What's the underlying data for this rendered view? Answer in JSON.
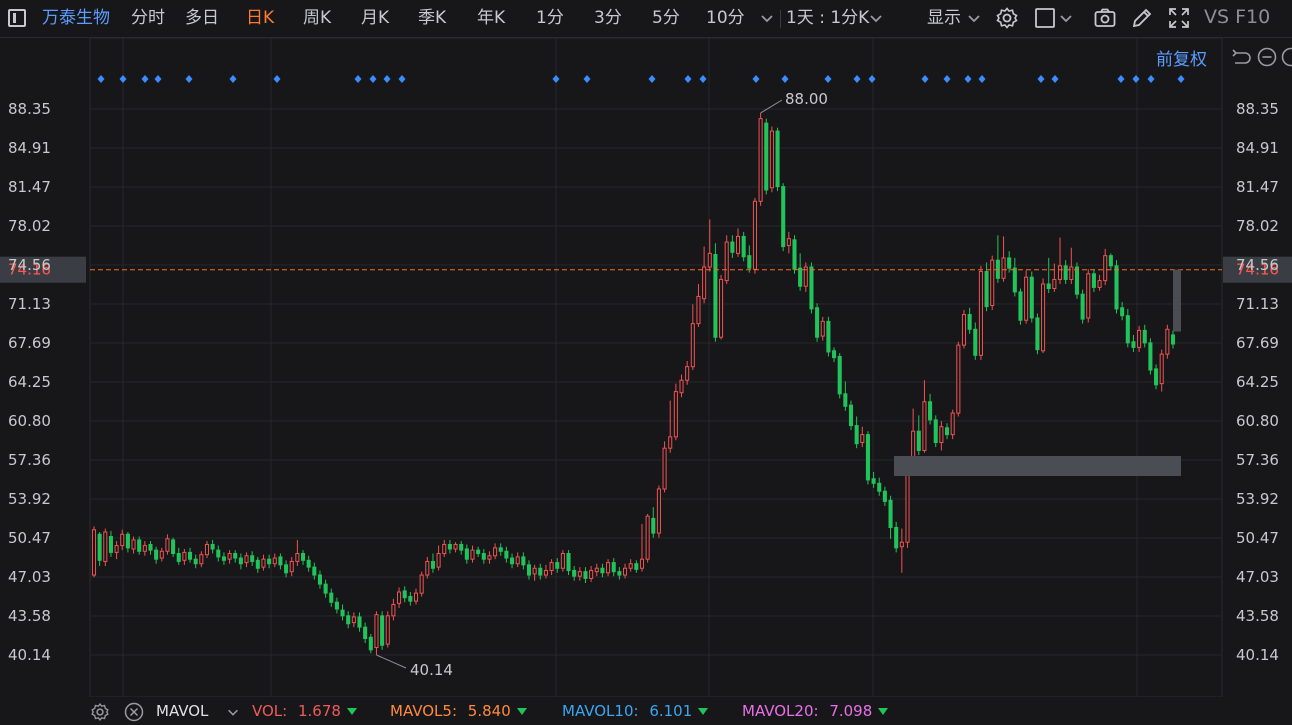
{
  "toolbar": {
    "stock_name": "万泰生物",
    "tabs": [
      "分时",
      "多日",
      "日K",
      "周K",
      "月K",
      "季K",
      "年K",
      "1分",
      "3分",
      "5分",
      "10分"
    ],
    "active_tab": "日K",
    "period_select": "1天 : 1分K",
    "display_label": "显示",
    "f10_label": "VS F10"
  },
  "row2": {
    "adjust_label": "前复权"
  },
  "chart_data": {
    "type": "candlestick",
    "y_axis_ticks": [
      "88.35",
      "84.91",
      "81.47",
      "78.02",
      "74.56",
      "71.13",
      "67.69",
      "64.25",
      "60.80",
      "57.36",
      "53.92",
      "50.47",
      "47.03",
      "43.58",
      "40.14"
    ],
    "ylim": [
      40.14,
      88.35
    ],
    "current_price": "74.16",
    "high_annotation": "88.00",
    "low_annotation": "40.14",
    "up_color": "#f05252",
    "down_color": "#21c45a",
    "candles": [
      [
        47.2,
        51.2,
        47.0,
        51.5
      ],
      [
        50.8,
        48.5,
        48.0,
        51.0
      ],
      [
        48.4,
        51.0,
        48.0,
        51.3
      ],
      [
        50.6,
        49.2,
        48.8,
        51.1
      ],
      [
        49.2,
        49.8,
        48.6,
        50.2
      ],
      [
        49.8,
        50.8,
        49.4,
        51.2
      ],
      [
        50.8,
        49.6,
        49.2,
        51.0
      ],
      [
        49.5,
        50.3,
        49.1,
        50.6
      ],
      [
        50.3,
        49.3,
        49.0,
        50.6
      ],
      [
        49.3,
        49.8,
        48.9,
        50.2
      ],
      [
        49.9,
        49.4,
        49.0,
        50.2
      ],
      [
        49.4,
        48.6,
        48.2,
        49.7
      ],
      [
        48.7,
        49.3,
        48.4,
        49.6
      ],
      [
        49.3,
        50.4,
        49.0,
        50.8
      ],
      [
        50.3,
        49.1,
        48.8,
        50.5
      ],
      [
        49.1,
        48.4,
        48.1,
        49.6
      ],
      [
        48.5,
        49.2,
        48.1,
        49.5
      ],
      [
        49.2,
        48.6,
        48.3,
        49.6
      ],
      [
        48.6,
        48.2,
        47.8,
        49.0
      ],
      [
        48.2,
        49.0,
        47.9,
        49.3
      ],
      [
        49.0,
        49.9,
        48.7,
        50.2
      ],
      [
        49.9,
        49.5,
        49.1,
        50.3
      ],
      [
        49.4,
        48.8,
        48.4,
        49.8
      ],
      [
        48.8,
        48.5,
        48.1,
        49.2
      ],
      [
        48.6,
        49.1,
        48.2,
        49.4
      ],
      [
        49.1,
        48.7,
        48.3,
        49.4
      ],
      [
        48.7,
        48.2,
        47.7,
        49.1
      ],
      [
        48.3,
        48.9,
        47.9,
        49.2
      ],
      [
        48.9,
        48.4,
        48.0,
        49.3
      ],
      [
        48.5,
        47.8,
        47.4,
        48.8
      ],
      [
        47.9,
        48.6,
        47.6,
        49.0
      ],
      [
        48.6,
        48.2,
        47.8,
        49.0
      ],
      [
        48.2,
        48.7,
        47.9,
        49.1
      ],
      [
        48.8,
        48.1,
        47.7,
        49.1
      ],
      [
        48.1,
        47.4,
        47.0,
        48.5
      ],
      [
        47.5,
        48.4,
        47.1,
        48.8
      ],
      [
        48.4,
        49.1,
        48.0,
        50.3
      ],
      [
        49.1,
        48.5,
        48.1,
        49.4
      ],
      [
        48.5,
        47.9,
        47.5,
        48.9
      ],
      [
        47.9,
        47.2,
        46.8,
        48.3
      ],
      [
        47.2,
        46.4,
        46.0,
        47.6
      ],
      [
        46.4,
        45.6,
        45.2,
        46.8
      ],
      [
        45.6,
        44.8,
        44.4,
        46.0
      ],
      [
        44.8,
        44.2,
        43.8,
        45.2
      ],
      [
        44.1,
        43.6,
        43.2,
        44.6
      ],
      [
        43.6,
        42.9,
        42.5,
        44.0
      ],
      [
        43.0,
        43.5,
        42.6,
        43.9
      ],
      [
        43.5,
        42.6,
        42.2,
        43.9
      ],
      [
        42.6,
        41.6,
        41.2,
        43.0
      ],
      [
        41.7,
        40.6,
        40.3,
        42.0
      ],
      [
        40.8,
        43.7,
        40.14,
        44.0
      ],
      [
        43.6,
        41.0,
        40.6,
        44.0
      ],
      [
        41.1,
        43.6,
        40.8,
        44.0
      ],
      [
        43.6,
        44.6,
        43.2,
        45.1
      ],
      [
        44.7,
        45.7,
        44.3,
        46.1
      ],
      [
        45.8,
        45.2,
        44.8,
        46.2
      ],
      [
        45.3,
        44.9,
        44.5,
        45.7
      ],
      [
        44.9,
        45.6,
        44.6,
        46.0
      ],
      [
        45.6,
        47.2,
        45.3,
        47.5
      ],
      [
        47.2,
        48.4,
        46.9,
        48.8
      ],
      [
        48.4,
        47.8,
        47.4,
        49.1
      ],
      [
        47.9,
        49.1,
        47.6,
        49.8
      ],
      [
        49.1,
        49.9,
        48.8,
        50.3
      ],
      [
        49.9,
        49.5,
        49.1,
        50.3
      ],
      [
        49.5,
        49.9,
        49.2,
        50.1
      ],
      [
        49.9,
        49.4,
        49.0,
        50.2
      ],
      [
        49.5,
        48.6,
        48.2,
        49.9
      ],
      [
        48.6,
        49.4,
        48.3,
        49.8
      ],
      [
        49.4,
        49.1,
        48.8,
        49.7
      ],
      [
        49.1,
        48.6,
        48.2,
        49.5
      ],
      [
        48.6,
        48.9,
        48.2,
        49.3
      ],
      [
        48.9,
        49.6,
        48.6,
        50.0
      ],
      [
        49.6,
        49.3,
        48.9,
        50.0
      ],
      [
        49.3,
        48.7,
        48.3,
        49.7
      ],
      [
        48.7,
        48.2,
        47.8,
        49.1
      ],
      [
        48.2,
        48.8,
        47.9,
        49.2
      ],
      [
        48.8,
        48.1,
        47.7,
        49.2
      ],
      [
        48.1,
        47.2,
        46.8,
        48.5
      ],
      [
        47.3,
        47.8,
        46.7,
        48.1
      ],
      [
        47.8,
        47.2,
        46.8,
        48.2
      ],
      [
        47.2,
        47.6,
        46.9,
        48.1
      ],
      [
        47.6,
        48.3,
        47.2,
        48.6
      ],
      [
        48.3,
        47.8,
        47.4,
        48.7
      ],
      [
        47.8,
        49.1,
        47.5,
        49.4
      ],
      [
        49.1,
        47.6,
        47.2,
        49.4
      ],
      [
        47.6,
        47.1,
        46.7,
        48.0
      ],
      [
        47.1,
        47.5,
        46.7,
        47.9
      ],
      [
        47.5,
        46.9,
        46.5,
        47.9
      ],
      [
        46.9,
        47.6,
        46.6,
        48.0
      ],
      [
        47.5,
        47.8,
        47.1,
        48.2
      ],
      [
        47.8,
        47.4,
        47.0,
        48.2
      ],
      [
        47.4,
        48.3,
        47.1,
        48.6
      ],
      [
        48.3,
        47.5,
        47.1,
        48.7
      ],
      [
        47.5,
        47.2,
        46.8,
        47.9
      ],
      [
        47.2,
        47.8,
        46.9,
        48.2
      ],
      [
        47.8,
        48.2,
        47.5,
        48.6
      ],
      [
        48.2,
        47.7,
        47.4,
        48.5
      ],
      [
        47.8,
        48.6,
        47.5,
        51.7
      ],
      [
        48.6,
        52.4,
        48.3,
        52.6
      ],
      [
        52.2,
        50.9,
        50.5,
        53.2
      ],
      [
        50.9,
        54.8,
        50.5,
        55.1
      ],
      [
        54.8,
        58.4,
        54.5,
        59.0
      ],
      [
        58.4,
        59.4,
        58.0,
        62.6
      ],
      [
        59.4,
        63.4,
        59.1,
        64.1
      ],
      [
        63.3,
        64.4,
        62.9,
        64.9
      ],
      [
        64.4,
        65.6,
        64.0,
        66.1
      ],
      [
        65.6,
        69.4,
        65.3,
        71.1
      ],
      [
        69.4,
        71.8,
        69.1,
        72.9
      ],
      [
        71.6,
        74.4,
        71.2,
        76.2
      ],
      [
        74.4,
        75.6,
        74.0,
        78.6
      ],
      [
        75.5,
        68.2,
        67.8,
        76.5
      ],
      [
        68.2,
        73.3,
        68.0,
        73.7
      ],
      [
        73.2,
        76.6,
        72.9,
        77.2
      ],
      [
        76.6,
        75.7,
        75.2,
        77.2
      ],
      [
        75.6,
        77.1,
        75.3,
        77.8
      ],
      [
        77.1,
        75.3,
        74.9,
        77.5
      ],
      [
        75.4,
        74.3,
        73.9,
        76.3
      ],
      [
        74.2,
        80.2,
        73.8,
        80.5
      ],
      [
        80.2,
        87.5,
        79.8,
        88.0
      ],
      [
        87.1,
        81.2,
        80.8,
        87.5
      ],
      [
        81.4,
        86.4,
        81.0,
        86.8
      ],
      [
        86.4,
        81.5,
        81.1,
        86.7
      ],
      [
        81.5,
        76.2,
        75.8,
        81.8
      ],
      [
        76.3,
        76.9,
        75.6,
        77.5
      ],
      [
        76.8,
        74.2,
        73.8,
        77.2
      ],
      [
        74.3,
        72.7,
        72.3,
        75.6
      ],
      [
        72.7,
        74.4,
        72.2,
        74.8
      ],
      [
        74.4,
        70.7,
        70.3,
        74.8
      ],
      [
        70.8,
        68.2,
        67.8,
        71.2
      ],
      [
        68.3,
        69.6,
        67.9,
        70.0
      ],
      [
        69.6,
        66.9,
        66.5,
        70.0
      ],
      [
        67.0,
        66.4,
        66.0,
        67.3
      ],
      [
        66.5,
        63.2,
        62.8,
        66.8
      ],
      [
        63.2,
        62.1,
        61.7,
        64.3
      ],
      [
        62.2,
        60.4,
        60.0,
        62.6
      ],
      [
        60.4,
        58.8,
        58.4,
        61.2
      ],
      [
        58.9,
        59.6,
        58.5,
        60.3
      ],
      [
        59.6,
        55.6,
        55.2,
        59.9
      ],
      [
        55.7,
        55.3,
        54.9,
        56.3
      ],
      [
        55.3,
        54.6,
        54.2,
        55.8
      ],
      [
        54.6,
        53.7,
        53.3,
        55.0
      ],
      [
        53.8,
        51.4,
        50.4,
        54.2
      ],
      [
        51.4,
        49.6,
        49.2,
        51.9
      ],
      [
        49.7,
        50.1,
        47.4,
        51.3
      ],
      [
        50.1,
        56.6,
        49.6,
        56.9
      ],
      [
        56.6,
        59.9,
        56.3,
        61.9
      ],
      [
        59.9,
        58.2,
        57.8,
        61.3
      ],
      [
        58.2,
        62.5,
        58.0,
        64.4
      ],
      [
        62.5,
        60.9,
        60.5,
        63.2
      ],
      [
        60.9,
        58.9,
        58.5,
        61.3
      ],
      [
        58.9,
        60.3,
        58.2,
        60.8
      ],
      [
        60.2,
        59.6,
        59.2,
        60.6
      ],
      [
        59.6,
        61.5,
        59.2,
        61.8
      ],
      [
        61.5,
        67.5,
        61.2,
        67.8
      ],
      [
        67.5,
        70.2,
        67.2,
        70.6
      ],
      [
        70.2,
        68.9,
        68.5,
        70.8
      ],
      [
        68.9,
        66.6,
        66.2,
        69.5
      ],
      [
        66.6,
        74.0,
        66.2,
        74.5
      ],
      [
        74.0,
        70.9,
        70.5,
        74.8
      ],
      [
        71.0,
        75.0,
        70.6,
        75.4
      ],
      [
        75.0,
        73.4,
        73.0,
        77.2
      ],
      [
        73.4,
        75.2,
        73.1,
        77.1
      ],
      [
        75.2,
        74.3,
        73.9,
        75.8
      ],
      [
        74.3,
        72.2,
        71.8,
        75.2
      ],
      [
        72.2,
        69.7,
        69.3,
        72.5
      ],
      [
        69.7,
        73.5,
        69.4,
        74.1
      ],
      [
        73.5,
        69.9,
        69.5,
        74.0
      ],
      [
        69.9,
        67.1,
        66.7,
        70.3
      ],
      [
        67.0,
        72.9,
        66.8,
        73.4
      ],
      [
        72.9,
        72.5,
        72.1,
        75.2
      ],
      [
        72.5,
        73.3,
        72.2,
        74.7
      ],
      [
        73.3,
        74.5,
        72.9,
        77.0
      ],
      [
        74.5,
        73.3,
        72.9,
        75.0
      ],
      [
        73.3,
        74.4,
        72.9,
        76.1
      ],
      [
        74.4,
        72.0,
        71.6,
        74.8
      ],
      [
        72.0,
        69.8,
        69.4,
        72.4
      ],
      [
        69.9,
        73.8,
        69.5,
        74.2
      ],
      [
        73.8,
        72.6,
        72.2,
        74.2
      ],
      [
        72.6,
        73.2,
        72.3,
        73.7
      ],
      [
        73.2,
        75.4,
        72.8,
        76.0
      ],
      [
        75.4,
        74.5,
        74.1,
        75.6
      ],
      [
        74.5,
        70.7,
        70.3,
        75.0
      ],
      [
        70.8,
        70.1,
        69.7,
        71.3
      ],
      [
        70.1,
        67.7,
        67.3,
        70.7
      ],
      [
        67.8,
        67.3,
        66.9,
        68.4
      ],
      [
        67.3,
        68.8,
        66.9,
        69.2
      ],
      [
        68.8,
        67.7,
        67.3,
        69.3
      ],
      [
        67.7,
        65.3,
        64.9,
        68.1
      ],
      [
        65.4,
        64.0,
        63.6,
        65.8
      ],
      [
        64.1,
        66.7,
        63.4,
        67.1
      ],
      [
        66.7,
        68.9,
        66.3,
        69.3
      ],
      [
        68.4,
        67.6,
        67.2,
        68.8
      ]
    ],
    "marker_positions": [
      101,
      123,
      145,
      158,
      189,
      233,
      277,
      358,
      373,
      387,
      402,
      556,
      587,
      652,
      688,
      703,
      756,
      785,
      828,
      857,
      872,
      925,
      947,
      968,
      982,
      1041,
      1055,
      1121,
      1136,
      1151,
      1181
    ]
  },
  "bottom_bar": {
    "indicator": "MAVOL",
    "vol_label": "VOL:",
    "vol_value": "1.678",
    "ma5_label": "MAVOL5:",
    "ma5_value": "5.840",
    "ma10_label": "MAVOL10:",
    "ma10_value": "6.101",
    "ma20_label": "MAVOL20:",
    "ma20_value": "7.098",
    "colors": {
      "vol": "#f05a5a",
      "ma5": "#ff8a3d",
      "ma10": "#3aa7f2",
      "ma20": "#e870e8"
    }
  }
}
